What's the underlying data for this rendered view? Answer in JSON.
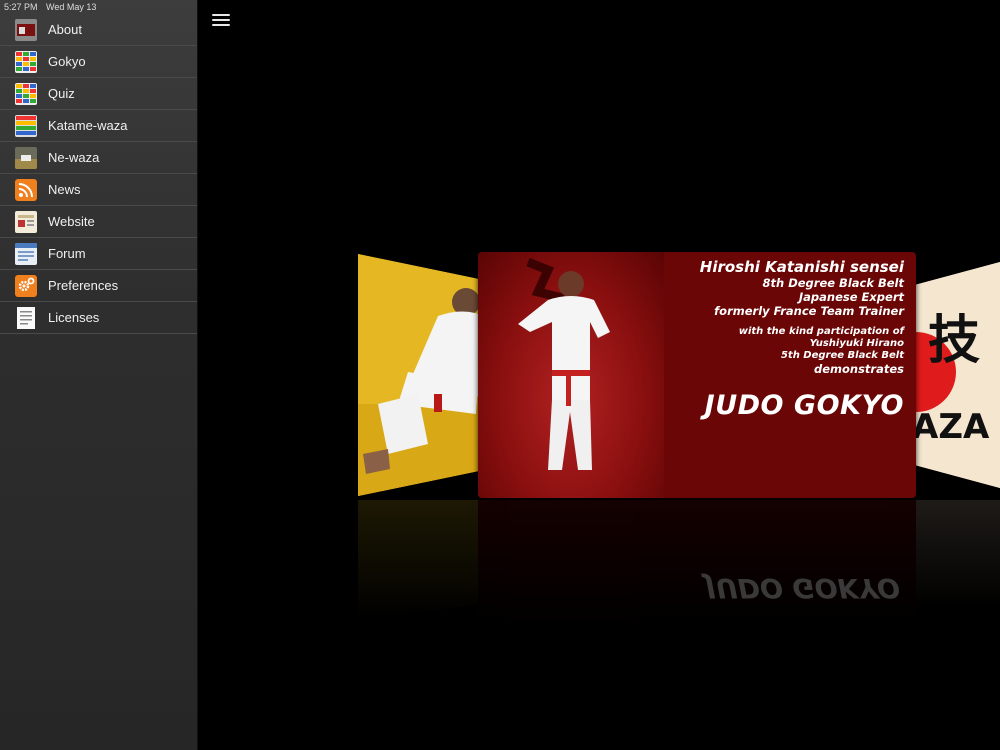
{
  "status": {
    "time": "5:27 PM",
    "date": "Wed May 13"
  },
  "menu": [
    {
      "label": "About",
      "icon": "about-thumbnail-icon"
    },
    {
      "label": "Gokyo",
      "icon": "gokyo-grid-icon"
    },
    {
      "label": "Quiz",
      "icon": "quiz-grid-icon"
    },
    {
      "label": "Katame-waza",
      "icon": "katame-waza-grid-icon"
    },
    {
      "label": "Ne-waza",
      "icon": "ne-waza-thumbnail-icon"
    },
    {
      "label": "News",
      "icon": "rss-icon"
    },
    {
      "label": "Website",
      "icon": "website-icon"
    },
    {
      "label": "Forum",
      "icon": "forum-icon"
    },
    {
      "label": "Preferences",
      "icon": "gear-icon"
    },
    {
      "label": "Licenses",
      "icon": "document-icon"
    }
  ],
  "cover": {
    "name": "Hiroshi Katanishi sensei",
    "line1": "8th Degree Black Belt",
    "line2": "Japanese Expert",
    "line3": "formerly France Team Trainer",
    "small1": "with the kind participation of",
    "small2": "Yushiyuki Hirano",
    "small3": "5th Degree Black Belt",
    "line4": "demonstrates",
    "title": "JUDO GOKYO"
  },
  "right_cover": {
    "kanji": "技",
    "text": "AZA"
  },
  "colors": {
    "sidebar": "#2e2e2e",
    "cover_red": "#6a0606",
    "left_cover_yellow": "#e2b722",
    "rss_orange": "#f07f1e"
  }
}
